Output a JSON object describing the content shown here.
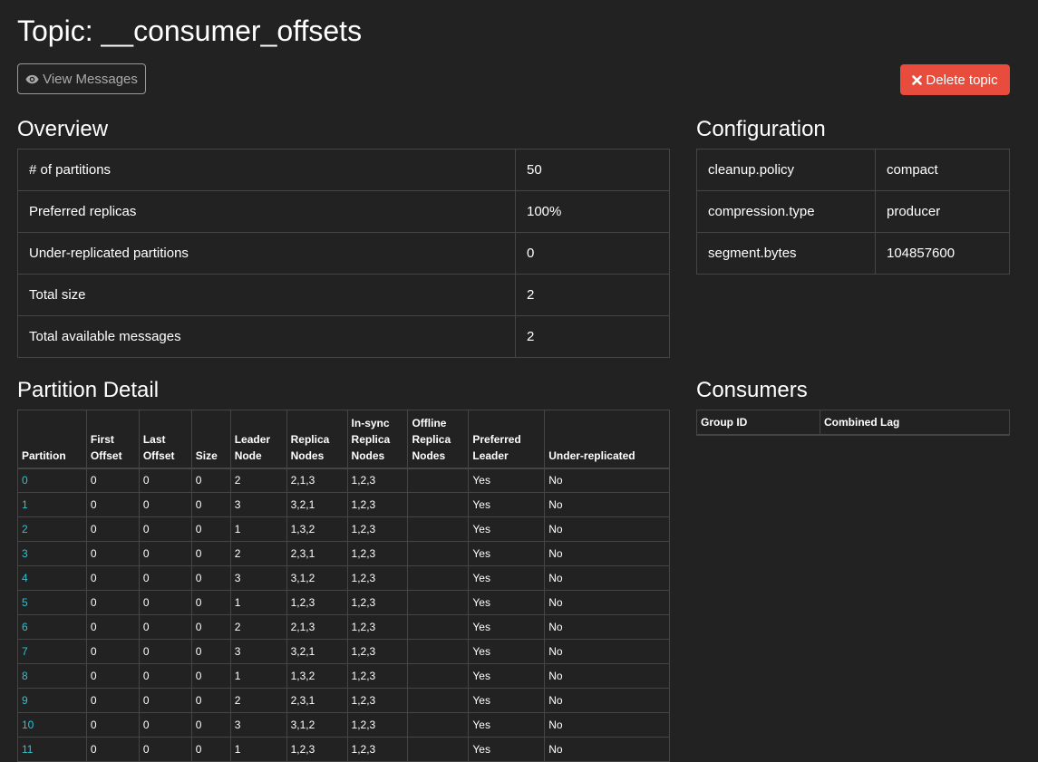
{
  "page": {
    "title": "Topic: __consumer_offsets"
  },
  "actions": {
    "view_messages": "View Messages",
    "delete_topic": "Delete topic"
  },
  "overview": {
    "title": "Overview",
    "rows": [
      {
        "label": "# of partitions",
        "value": "50"
      },
      {
        "label": "Preferred replicas",
        "value": "100%"
      },
      {
        "label": "Under-replicated partitions",
        "value": "0"
      },
      {
        "label": "Total size",
        "value": "2"
      },
      {
        "label": "Total available messages",
        "value": "2"
      }
    ]
  },
  "configuration": {
    "title": "Configuration",
    "rows": [
      {
        "key": "cleanup.policy",
        "value": "compact"
      },
      {
        "key": "compression.type",
        "value": "producer"
      },
      {
        "key": "segment.bytes",
        "value": "104857600"
      }
    ]
  },
  "consumers": {
    "title": "Consumers",
    "headers": [
      "Group ID",
      "Combined Lag"
    ]
  },
  "partition_detail": {
    "title": "Partition Detail",
    "headers": [
      [
        "Partition"
      ],
      [
        "First",
        "Offset"
      ],
      [
        "Last",
        "Offset"
      ],
      [
        "Size"
      ],
      [
        "Leader",
        "Node"
      ],
      [
        "Replica",
        "Nodes"
      ],
      [
        "In-sync",
        "Replica",
        "Nodes"
      ],
      [
        "Offline",
        "Replica",
        "Nodes"
      ],
      [
        "Preferred",
        "Leader"
      ],
      [
        "Under-replicated"
      ]
    ],
    "rows": [
      [
        "0",
        "0",
        "0",
        "0",
        "2",
        "2,1,3",
        "1,2,3",
        "",
        "Yes",
        "No"
      ],
      [
        "1",
        "0",
        "0",
        "0",
        "3",
        "3,2,1",
        "1,2,3",
        "",
        "Yes",
        "No"
      ],
      [
        "2",
        "0",
        "0",
        "0",
        "1",
        "1,3,2",
        "1,2,3",
        "",
        "Yes",
        "No"
      ],
      [
        "3",
        "0",
        "0",
        "0",
        "2",
        "2,3,1",
        "1,2,3",
        "",
        "Yes",
        "No"
      ],
      [
        "4",
        "0",
        "0",
        "0",
        "3",
        "3,1,2",
        "1,2,3",
        "",
        "Yes",
        "No"
      ],
      [
        "5",
        "0",
        "0",
        "0",
        "1",
        "1,2,3",
        "1,2,3",
        "",
        "Yes",
        "No"
      ],
      [
        "6",
        "0",
        "0",
        "0",
        "2",
        "2,1,3",
        "1,2,3",
        "",
        "Yes",
        "No"
      ],
      [
        "7",
        "0",
        "0",
        "0",
        "3",
        "3,2,1",
        "1,2,3",
        "",
        "Yes",
        "No"
      ],
      [
        "8",
        "0",
        "0",
        "0",
        "1",
        "1,3,2",
        "1,2,3",
        "",
        "Yes",
        "No"
      ],
      [
        "9",
        "0",
        "0",
        "0",
        "2",
        "2,3,1",
        "1,2,3",
        "",
        "Yes",
        "No"
      ],
      [
        "10",
        "0",
        "0",
        "0",
        "3",
        "3,1,2",
        "1,2,3",
        "",
        "Yes",
        "No"
      ],
      [
        "11",
        "0",
        "0",
        "0",
        "1",
        "1,2,3",
        "1,2,3",
        "",
        "Yes",
        "No"
      ]
    ]
  },
  "icons": {
    "view": "eye-icon",
    "delete": "times-icon"
  },
  "colors": {
    "background": "#222222",
    "danger": "#e74c3c",
    "link": "#1fc8db",
    "border": "#464545"
  }
}
